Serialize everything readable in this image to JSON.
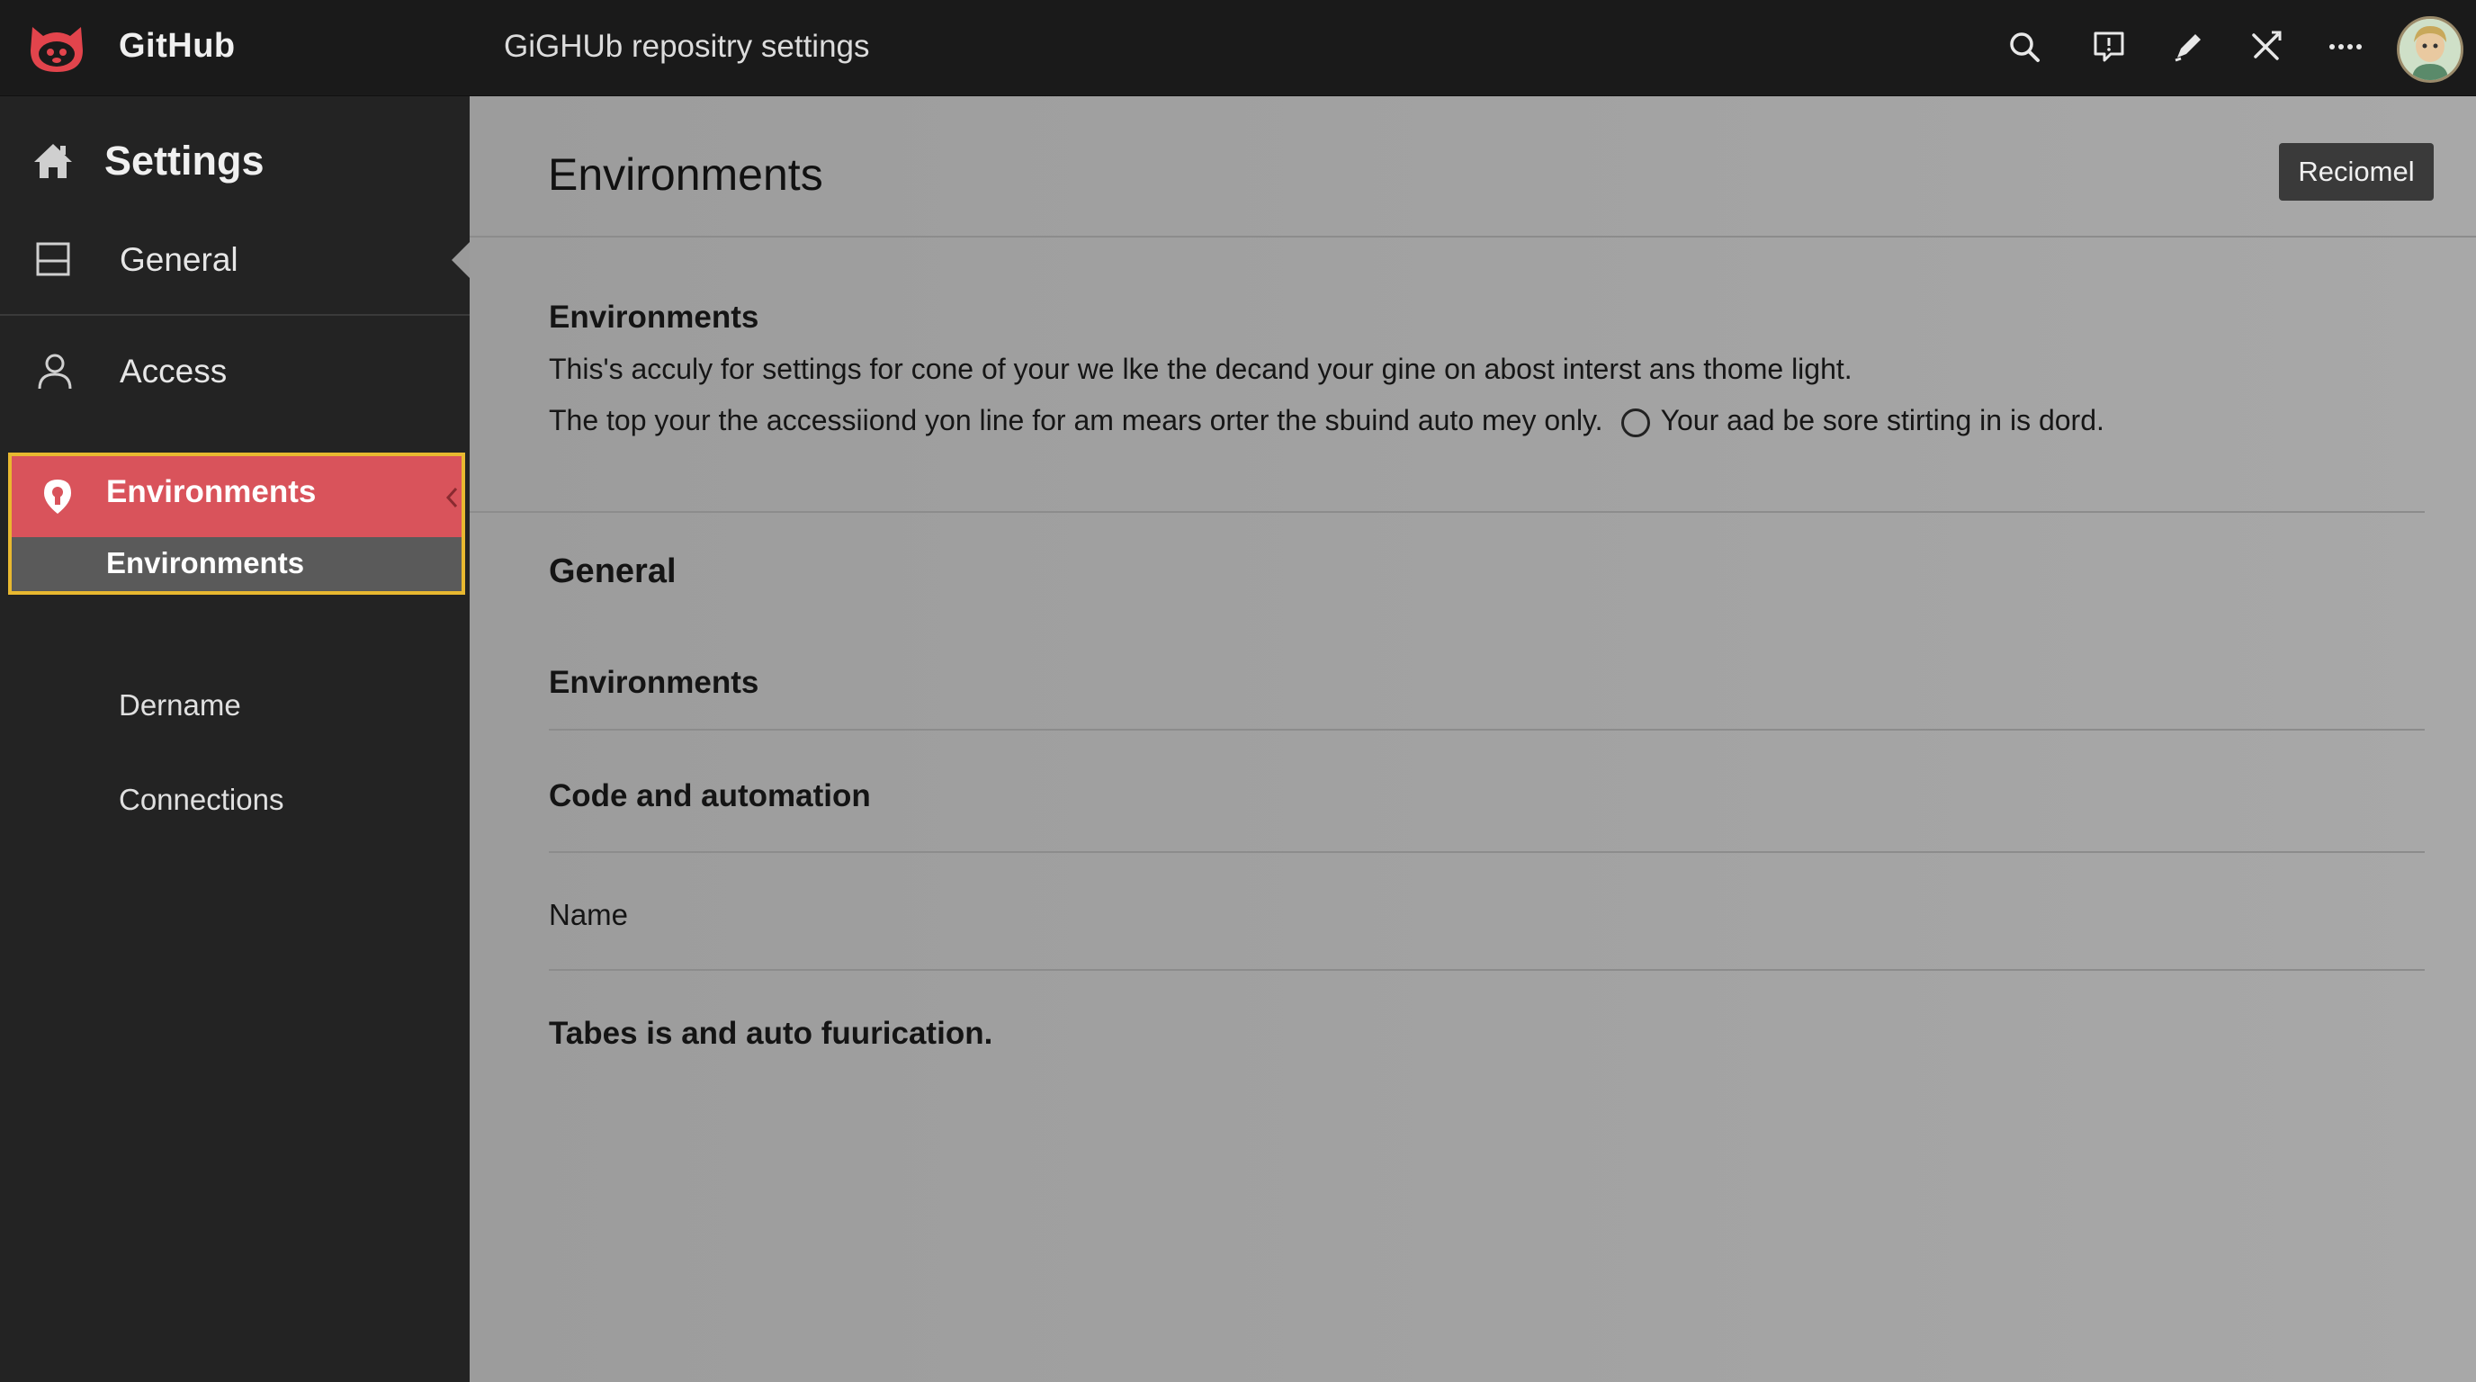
{
  "topbar": {
    "brand": "GitHub",
    "page_title": "GiGHUb repositry settings",
    "icons": [
      "search-icon",
      "feedback-icon",
      "pen-icon",
      "tools-icon",
      "more-icon"
    ]
  },
  "sidebar": {
    "header": "Settings",
    "items": [
      {
        "label": "General",
        "icon": "layout-icon"
      },
      {
        "label": "Access",
        "icon": "person-icon"
      }
    ],
    "active_group": {
      "label": "Environments",
      "sub_label": "Environments"
    },
    "plain_items": [
      "Dername",
      "Connections"
    ]
  },
  "main": {
    "title": "Environments",
    "action_button": "Reciomel",
    "section": {
      "title": "Environments",
      "line1": "This's acculy for settings for cone of your we lke the decand your gine on abost interst ans thome light.",
      "line2_a": "The top your the accessiiond yon line for am mears orter the sbuind auto mey only.",
      "line2_b": "Your aad be sore stirting in is dord."
    },
    "rows": {
      "general": "General",
      "environments": "Environments",
      "code_automation": "Code and automation",
      "name": "Name",
      "tabes": "Tabes is and auto fuurication."
    }
  },
  "colors": {
    "accent_active": "#d9535b",
    "highlight_border": "#e8b830",
    "sidebar_bg": "#232323",
    "main_bg": "#a0a0a0"
  }
}
